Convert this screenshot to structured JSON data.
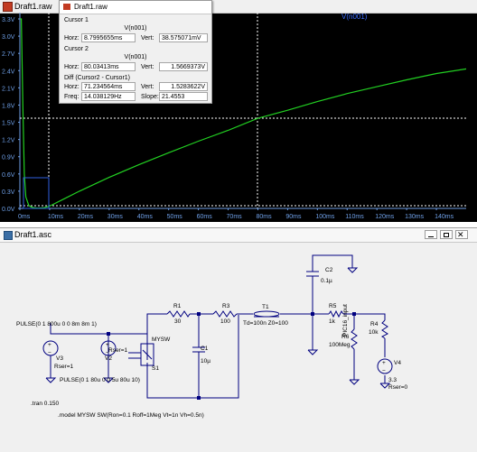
{
  "plot_window": {
    "title": "Draft1.raw",
    "trace_label": "V(n001)",
    "y_ticks": [
      "3.3V",
      "3.0V",
      "2.7V",
      "2.4V",
      "2.1V",
      "1.8V",
      "1.5V",
      "1.2V",
      "0.9V",
      "0.6V",
      "0.3V",
      "0.0V"
    ],
    "x_ticks": [
      "0ms",
      "10ms",
      "20ms",
      "30ms",
      "40ms",
      "50ms",
      "60ms",
      "70ms",
      "80ms",
      "90ms",
      "100ms",
      "110ms",
      "120ms",
      "130ms",
      "140ms"
    ],
    "colors": {
      "background": "#000000",
      "trace": "#22d022",
      "axis_text": "#6fa0e8",
      "cursor": "#ffffff",
      "trace_label": "#3a6cff"
    }
  },
  "chart_data": {
    "type": "line",
    "title": "",
    "xlabel": "",
    "ylabel": "",
    "xlim": [
      0,
      150
    ],
    "ylim": [
      0,
      3.3
    ],
    "x_unit": "ms",
    "y_unit": "V",
    "grid": false,
    "series": [
      {
        "name": "V(n001)",
        "x": [
          0,
          0.5,
          1,
          1.5,
          2,
          3,
          4,
          5,
          6,
          8,
          10,
          15,
          20,
          30,
          40,
          50,
          60,
          70,
          80,
          90,
          100,
          110,
          120,
          130,
          140,
          150
        ],
        "y": [
          3.3,
          3.3,
          1.8,
          0.6,
          0.2,
          0.05,
          0.02,
          0.01,
          0.005,
          0.01,
          0.04,
          0.17,
          0.3,
          0.54,
          0.76,
          0.97,
          1.17,
          1.36,
          1.57,
          1.71,
          1.86,
          2.0,
          2.12,
          2.24,
          2.35,
          2.43
        ]
      }
    ],
    "cursors": [
      {
        "label": "Cursor 1",
        "x": 8.7995655,
        "y": 0.0385751
      },
      {
        "label": "Cursor 2",
        "x": 80.03413,
        "y": 1.5669373
      }
    ]
  },
  "cursor_dialog": {
    "title": "Draft1.raw",
    "cursor1": {
      "heading": "Cursor 1",
      "trace": "V(n001)",
      "horz_label": "Horz:",
      "horz": "8.7995655ms",
      "vert_label": "Vert:",
      "vert": "38.575071mV"
    },
    "cursor2": {
      "heading": "Cursor 2",
      "trace": "V(n001)",
      "horz_label": "Horz:",
      "horz": "80.03413ms",
      "vert_label": "Vert:",
      "vert": "1.5669373V"
    },
    "diff": {
      "heading": "Diff (Cursor2 - Cursor1)",
      "horz_label": "Horz:",
      "horz": "71.234564ms",
      "vert_label": "Vert:",
      "vert": "1.5283622V",
      "freq_label": "Freq:",
      "freq": "14.038129Hz",
      "slope_label": "Slope:",
      "slope": "21.4553"
    }
  },
  "schematic_window": {
    "title": "Draft1.asc",
    "labels": {
      "pulse1": "PULSE(0 1 800u 0 0 8m 8m 1)",
      "pulse2": "PULSE(0 1 80u 0 0 5u 80u 10)",
      "v3": "V3",
      "v3_rser": "Rser=1",
      "v2": "V2",
      "v2_rser": "Rser=1",
      "mysw": "MYSW",
      "s1": "S1",
      "r1": "R1",
      "r1_val": "30",
      "r3": "R3",
      "r3_val": "100",
      "t1": "T1",
      "t1_val": "Td=100n Z0=100",
      "c1": "C1",
      "c1_val": "10µ",
      "c2": "C2",
      "c2_val": "0.1µ",
      "r5": "R5",
      "r5_val": "1k",
      "r4": "R4",
      "r4_val": "10k",
      "pic": "PIC16_input",
      "r6": "R6",
      "r6_val": "100Meg",
      "v4": "V4",
      "v4_val": "3.3",
      "v4_rser": "Rser=0",
      "tran": ".tran 0.150",
      "model": ".model MYSW SW(Ron=0.1 Roff=1Meg Vt=1n Vh=0.5n)"
    }
  }
}
